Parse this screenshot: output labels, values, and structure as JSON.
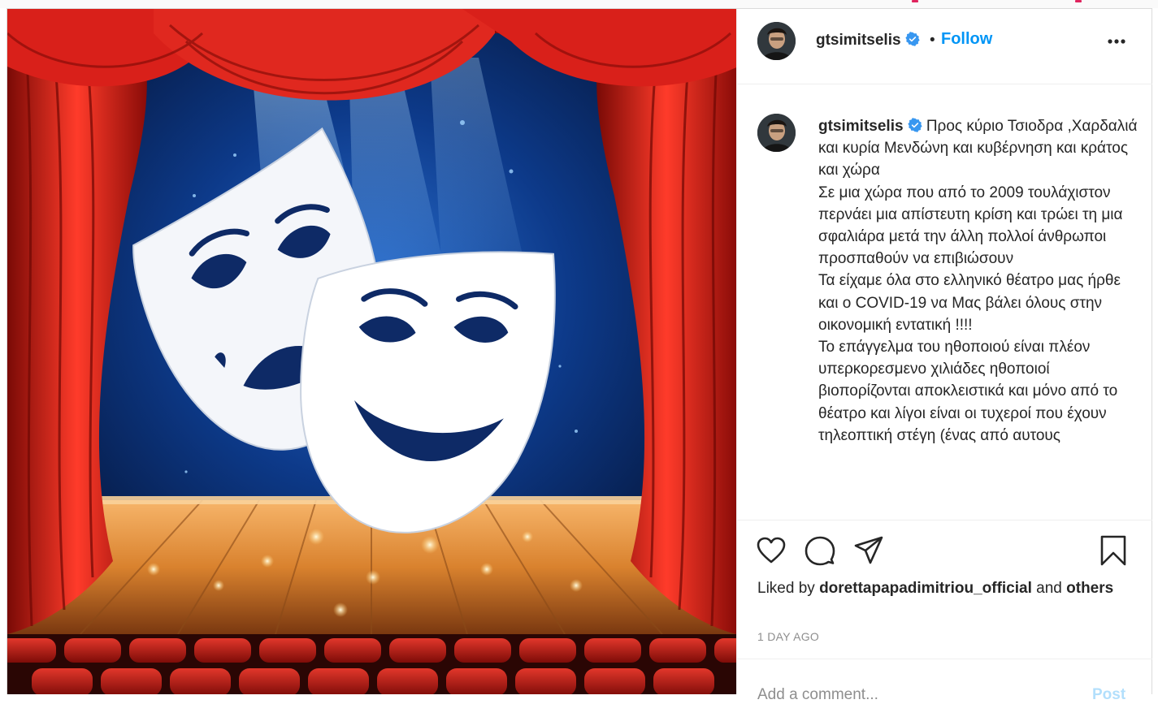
{
  "post": {
    "username": "gtsimitselis",
    "dot": "•",
    "follow_label": "Follow",
    "caption": "Προς κύριο Τσιοδρα ,Χαρδαλιά και κυρία Μενδώνη και κυβέρνηση και κράτος και χώρα\nΣε μια χώρα που από το 2009 τουλάχιστον περνάει μια απίστευτη κρίση και τρώει τη μια σφαλιάρα μετά την άλλη πολλοί άνθρωποι προσπαθούν να επιβιώσουν\nΤα είχαμε όλα στο ελληνικό θέατρο μας ήρθε και ο COVID-19 να Μας βάλει όλους στην οικονομική εντατική !!!!\nΤο επάγγελμα του ηθοποιού είναι πλέον υπερκορεσμενο χιλιάδες ηθοποιοί βιοπορίζονται αποκλειστικά και μόνο από το θέατρο και λίγοι είναι οι τυχεροί που έχουν τηλεοπτική στέγη (ένας από αυτους",
    "liked_by_prefix": "Liked by",
    "liked_by_user": "dorettapapadimitriou_official",
    "liked_by_and": "and",
    "liked_by_others": "others",
    "timestamp": "1 DAY AGO",
    "comment_placeholder": "Add a comment...",
    "post_label": "Post"
  },
  "icons": {
    "verified": "verified-badge-icon",
    "more": "more-options-icon",
    "like": "heart-icon",
    "comment": "comment-icon",
    "share": "share-icon",
    "save": "bookmark-icon"
  },
  "colors": {
    "follow": "#0095f6",
    "verified": "#3897f0",
    "muted": "#8e8e8e",
    "curtain": "#d21a14"
  }
}
